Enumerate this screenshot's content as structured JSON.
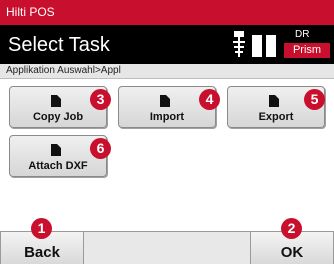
{
  "app": {
    "title": "Hilti POS"
  },
  "header": {
    "title": "Select Task",
    "mode": "DR",
    "target": "Prism",
    "icons": [
      "pole-icon",
      "instrument-icon"
    ]
  },
  "breadcrumb": "Applikation Auswahl>Appl",
  "tasks": [
    {
      "label": "Copy Job",
      "badge": "3",
      "icon": "document-icon"
    },
    {
      "label": "Import",
      "badge": "4",
      "icon": "document-icon"
    },
    {
      "label": "Export",
      "badge": "5",
      "icon": "document-icon"
    },
    {
      "label": "Attach DXF",
      "badge": "6",
      "icon": "document-icon"
    }
  ],
  "footer": {
    "back": {
      "label": "Back",
      "badge": "1"
    },
    "ok": {
      "label": "OK",
      "badge": "2"
    }
  },
  "colors": {
    "brand_red": "#c8102e",
    "header_bg": "#000000",
    "button_bg": "#e0e0e0"
  }
}
